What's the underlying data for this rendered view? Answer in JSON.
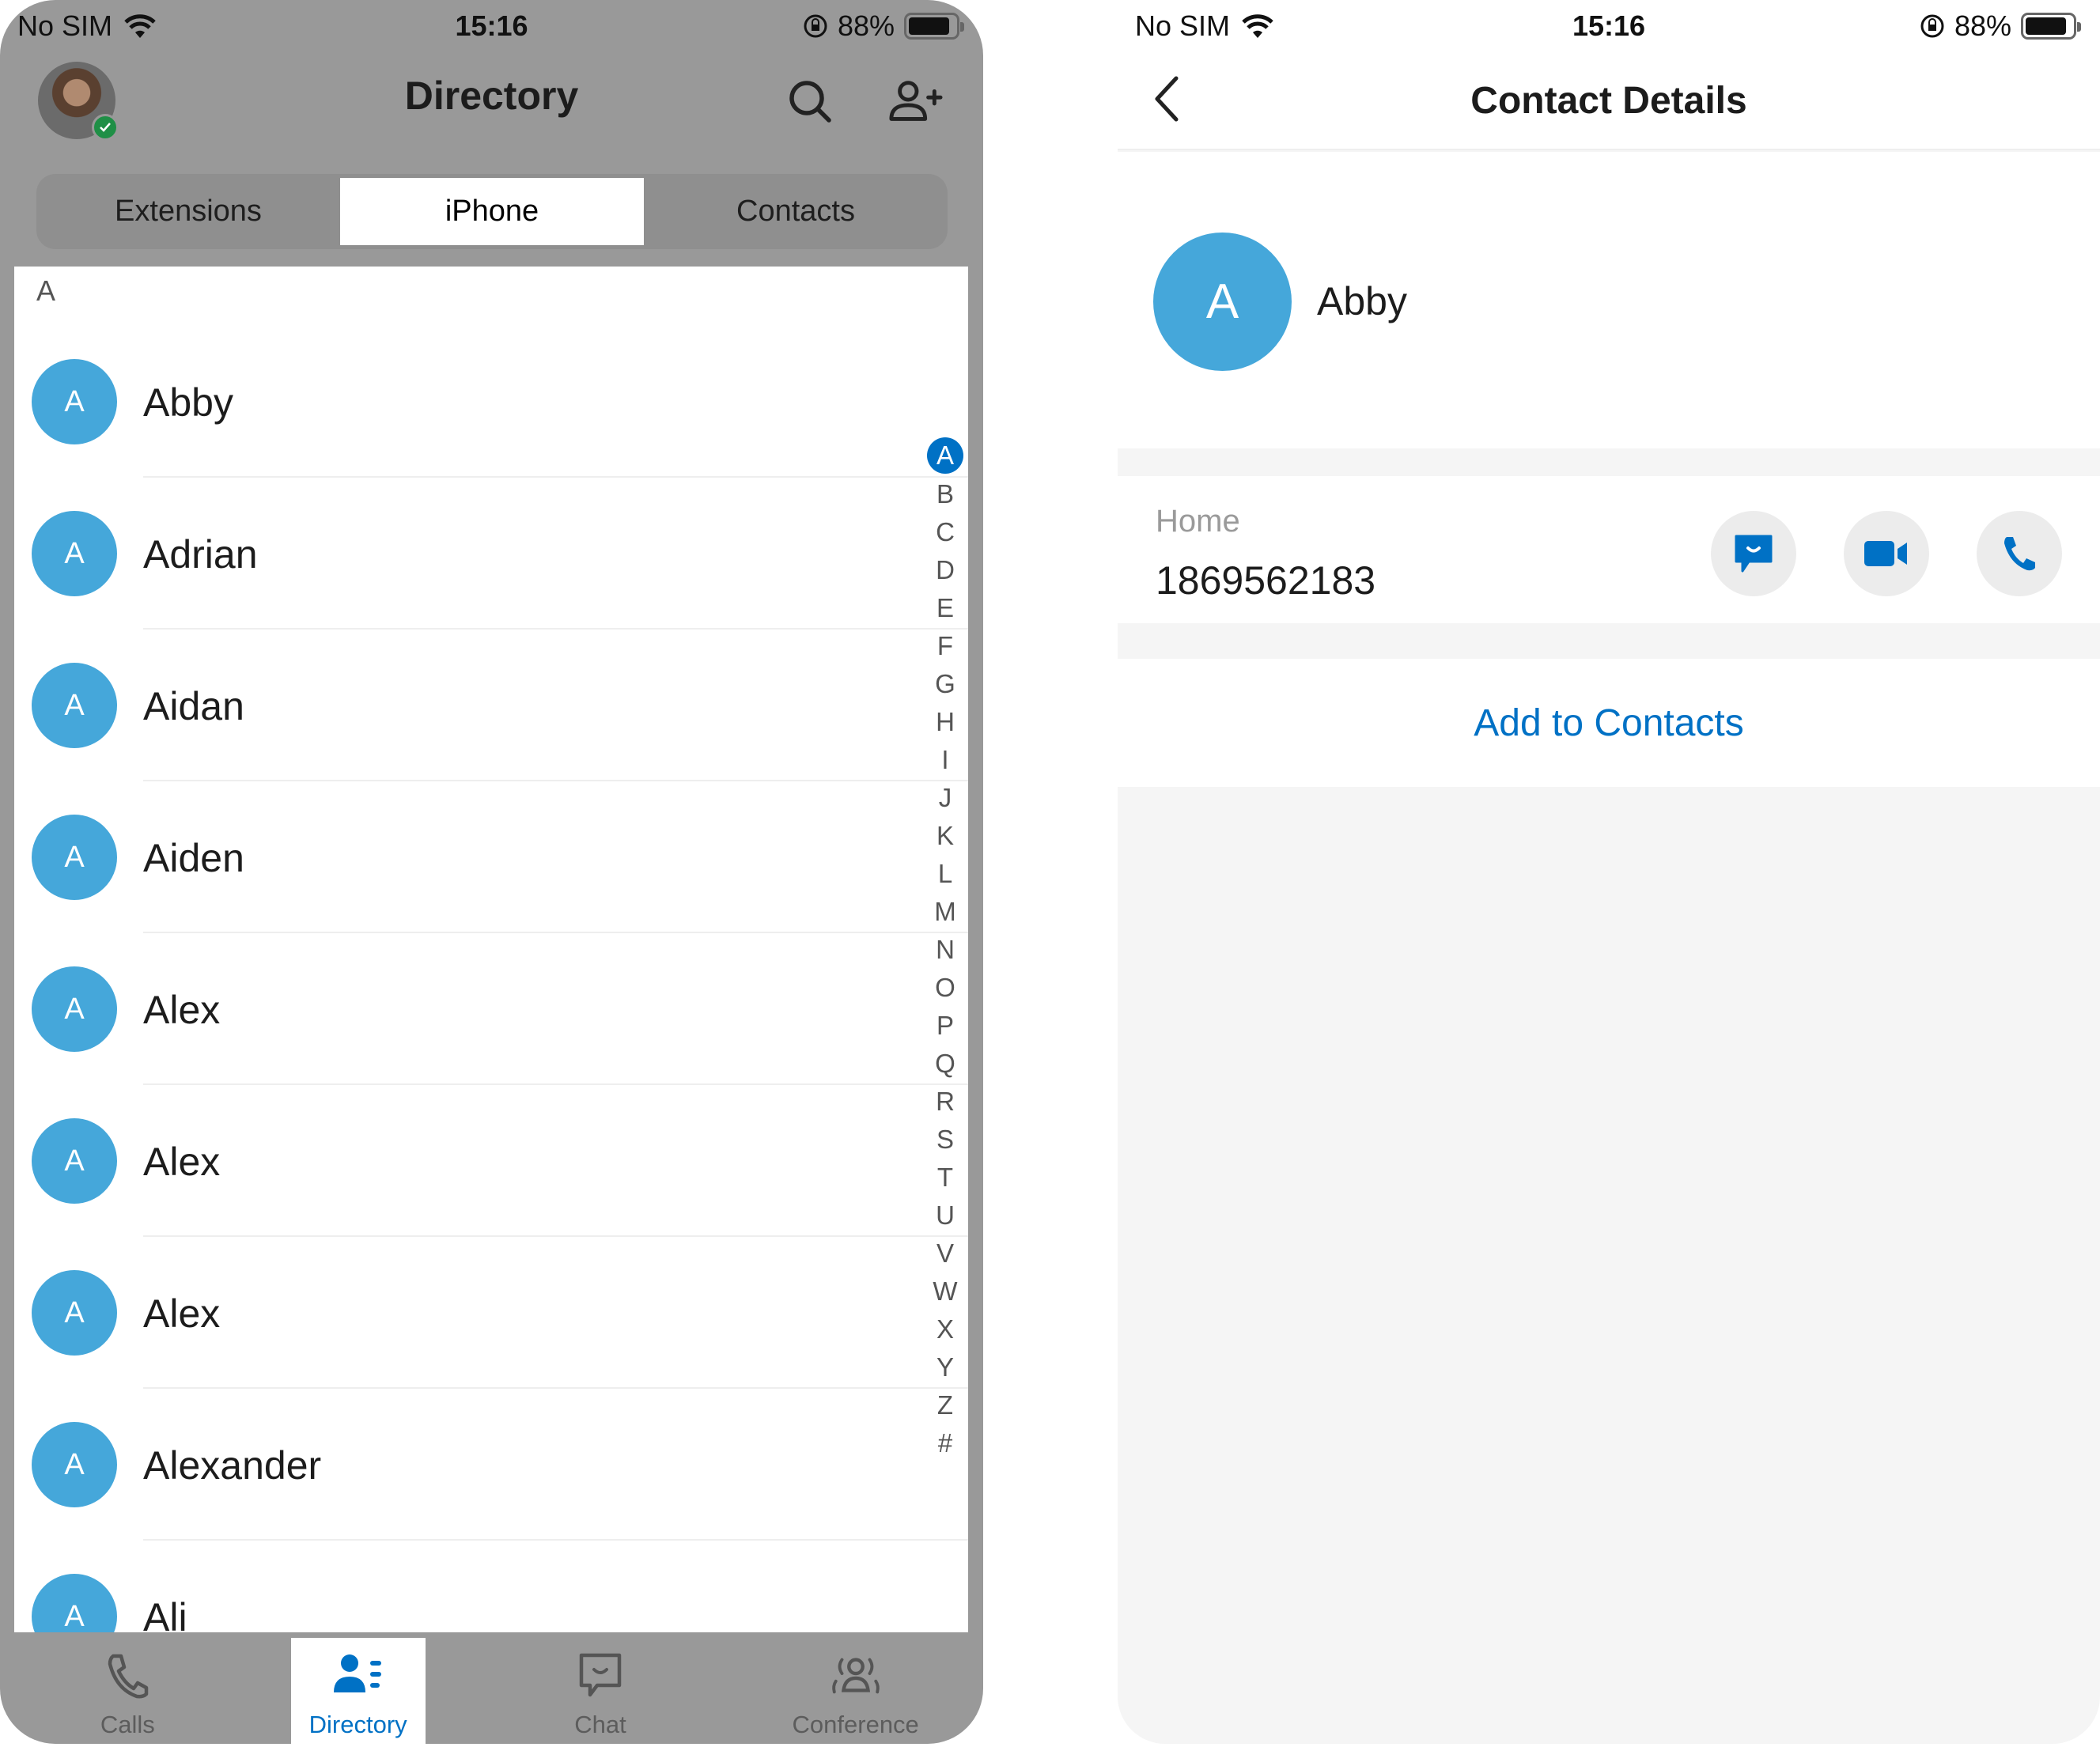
{
  "status_bar": {
    "carrier": "No SIM",
    "time": "15:16",
    "battery_percent": "88%",
    "battery_level": 0.88,
    "icons": [
      "wifi-icon",
      "orientation-lock-icon",
      "battery-icon"
    ]
  },
  "directory_screen": {
    "title": "Directory",
    "header_icons": [
      "search-icon",
      "add-contact-icon"
    ],
    "user_presence": "available",
    "segments": [
      {
        "label": "Extensions",
        "active": false
      },
      {
        "label": "iPhone",
        "active": true
      },
      {
        "label": "Contacts",
        "active": false
      }
    ],
    "section_letter": "A",
    "contacts": [
      {
        "initial": "A",
        "name": "Abby"
      },
      {
        "initial": "A",
        "name": "Adrian"
      },
      {
        "initial": "A",
        "name": "Aidan"
      },
      {
        "initial": "A",
        "name": "Aiden"
      },
      {
        "initial": "A",
        "name": "Alex"
      },
      {
        "initial": "A",
        "name": "Alex"
      },
      {
        "initial": "A",
        "name": "Alex"
      },
      {
        "initial": "A",
        "name": "Alexander"
      },
      {
        "initial": "A",
        "name": "Ali"
      }
    ],
    "alpha_index": [
      "A",
      "B",
      "C",
      "D",
      "E",
      "F",
      "G",
      "H",
      "I",
      "J",
      "K",
      "L",
      "M",
      "N",
      "O",
      "P",
      "Q",
      "R",
      "S",
      "T",
      "U",
      "V",
      "W",
      "X",
      "Y",
      "Z",
      "#"
    ],
    "alpha_index_active": "A",
    "tabs": [
      {
        "label": "Calls",
        "icon": "phone-icon",
        "active": false
      },
      {
        "label": "Directory",
        "icon": "directory-icon",
        "active": true
      },
      {
        "label": "Chat",
        "icon": "chat-icon",
        "active": false
      },
      {
        "label": "Conference",
        "icon": "conference-icon",
        "active": false
      }
    ]
  },
  "details_screen": {
    "title": "Contact Details",
    "contact": {
      "initial": "A",
      "name": "Abby"
    },
    "phone": {
      "label": "Home",
      "number": "1869562183"
    },
    "actions": [
      "message-icon",
      "video-call-icon",
      "call-icon"
    ],
    "add_button": "Add to Contacts"
  },
  "colors": {
    "accent": "#0071c5",
    "avatar": "#45a7da",
    "overlay_dim": "#999999",
    "presence": "#1f8f46"
  }
}
